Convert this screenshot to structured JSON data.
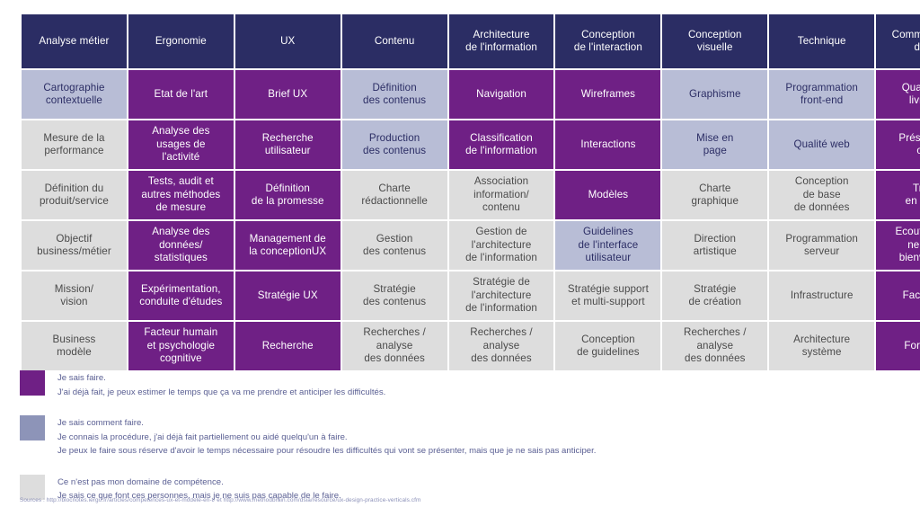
{
  "matrix": {
    "columns": [
      "Analyse métier",
      "Ergonomie",
      "UX",
      "Contenu",
      "Architecture\nde l'information",
      "Conception\nde l'interaction",
      "Conception\nvisuelle",
      "Technique",
      "Communication\ndouce"
    ],
    "rows": [
      [
        {
          "label": "Cartographie\ncontextuelle",
          "level": "known"
        },
        {
          "label": "Etat de l'art",
          "level": "expert"
        },
        {
          "label": "Brief UX",
          "level": "expert"
        },
        {
          "label": "Définition\ndes contenus",
          "level": "known"
        },
        {
          "label": "Navigation",
          "level": "expert"
        },
        {
          "label": "Wireframes",
          "level": "expert"
        },
        {
          "label": "Graphisme",
          "level": "known"
        },
        {
          "label": "Programmation\nfront-end",
          "level": "known"
        },
        {
          "label": "Qualité des\nlivrables",
          "level": "expert"
        }
      ],
      [
        {
          "label": "Mesure de la\nperformance",
          "level": "none"
        },
        {
          "label": "Analyse des\nusages de\nl'activité",
          "level": "expert"
        },
        {
          "label": "Recherche\nutilisateur",
          "level": "expert"
        },
        {
          "label": "Production\ndes contenus",
          "level": "known"
        },
        {
          "label": "Classification\nde l'information",
          "level": "expert"
        },
        {
          "label": "Interactions",
          "level": "expert"
        },
        {
          "label": "Mise en\npage",
          "level": "known"
        },
        {
          "label": "Qualité web",
          "level": "known"
        },
        {
          "label": "Présentation\norale",
          "level": "expert"
        }
      ],
      [
        {
          "label": "Définition du\nproduit/service",
          "level": "none"
        },
        {
          "label": "Tests, audit et\nautres méthodes\nde mesure",
          "level": "expert"
        },
        {
          "label": "Définition\nde la promesse",
          "level": "expert"
        },
        {
          "label": "Charte\nrédactionnelle",
          "level": "none"
        },
        {
          "label": "Association\ninformation/\ncontenu",
          "level": "none"
        },
        {
          "label": "Modèles",
          "level": "expert"
        },
        {
          "label": "Charte\ngraphique",
          "level": "none"
        },
        {
          "label": "Conception\nde base\nde données",
          "level": "none"
        },
        {
          "label": "Travail\nen équipe",
          "level": "expert"
        }
      ],
      [
        {
          "label": "Objectif\nbusiness/métier",
          "level": "none"
        },
        {
          "label": "Analyse des\ndonnées/\nstatistiques",
          "level": "expert"
        },
        {
          "label": "Management de\nla conceptionUX",
          "level": "expert"
        },
        {
          "label": "Gestion\ndes contenus",
          "level": "none"
        },
        {
          "label": "Gestion de\nl'architecture\nde l'information",
          "level": "none"
        },
        {
          "label": "Guidelines\nde l'interface\nutilisateur",
          "level": "known"
        },
        {
          "label": "Direction\nartistique",
          "level": "none"
        },
        {
          "label": "Programmation\nserveur",
          "level": "none"
        },
        {
          "label": "Ecoute active,\nneutre et\nbienveillante",
          "level": "expert"
        }
      ],
      [
        {
          "label": "Mission/\nvision",
          "level": "none"
        },
        {
          "label": "Expérimentation,\nconduite d'études",
          "level": "expert"
        },
        {
          "label": "Stratégie UX",
          "level": "expert"
        },
        {
          "label": "Stratégie\ndes contenus",
          "level": "none"
        },
        {
          "label": "Stratégie de\nl'architecture\nde l'information",
          "level": "none"
        },
        {
          "label": "Stratégie support\net multi-support",
          "level": "none"
        },
        {
          "label": "Stratégie\nde création",
          "level": "none"
        },
        {
          "label": "Infrastructure",
          "level": "none"
        },
        {
          "label": "Facilitateur",
          "level": "expert"
        }
      ],
      [
        {
          "label": "Business\nmodèle",
          "level": "none"
        },
        {
          "label": "Facteur humain\net psychologie\ncognitive",
          "level": "expert"
        },
        {
          "label": "Recherche",
          "level": "expert"
        },
        {
          "label": "Recherches /\nanalyse\ndes données",
          "level": "none"
        },
        {
          "label": "Recherches /\nanalyse\ndes données",
          "level": "none"
        },
        {
          "label": "Conception\nde guidelines",
          "level": "none"
        },
        {
          "label": "Recherches /\nanalyse\ndes données",
          "level": "none"
        },
        {
          "label": "Architecture\nsystème",
          "level": "none"
        },
        {
          "label": "Formateur",
          "level": "expert"
        }
      ]
    ]
  },
  "legend": [
    {
      "level": "expert",
      "color": "#6f2085",
      "lines": [
        "Je sais faire.",
        "J'ai déjà fait, je peux estimer le temps que ça va me prendre et anticiper les difficultés."
      ]
    },
    {
      "level": "known",
      "color": "#8d94b8",
      "lines": [
        "Je sais comment faire.",
        "Je connais la procédure, j'ai déjà fait partiellement ou aidé quelqu'un à faire.",
        "Je peux le faire sous réserve d'avoir le temps nécessaire pour résoudre les difficultés qui vont se présenter, mais que je ne sais pas anticiper."
      ]
    },
    {
      "level": "none",
      "color": "#dddddd",
      "lines": [
        "Ce n'est pas mon domaine de compétence.",
        "Je sais ce que font ces personnes, mais je ne suis pas capable de le faire."
      ]
    }
  ],
  "sources": "Sources : http://blocnotes.iergo.fr/articles/competences-ux-et-modele-en-t/ et http://www.methodbrain.com/dsia/resource/ux-design-practice-verticals.cfm",
  "colors": {
    "header_bg": "#2b2d64",
    "expert": "#6f2085",
    "known": "#b8bdd6",
    "none": "#dddddd",
    "legend_text": "#5a5f93"
  }
}
